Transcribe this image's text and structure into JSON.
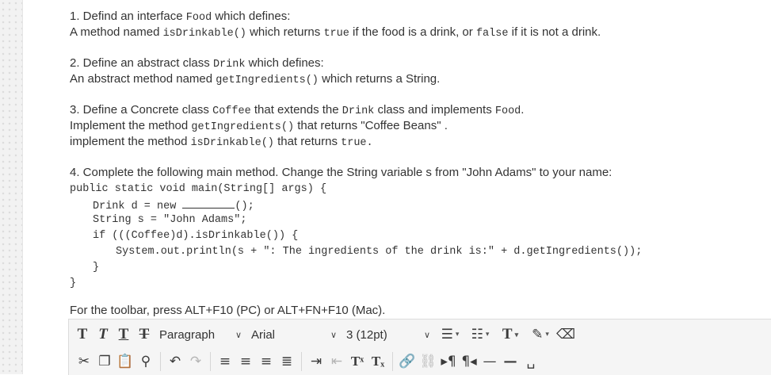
{
  "questions": {
    "q1": {
      "l1_a": "1. Defind an interface ",
      "l1_code": "Food",
      "l1_b": " which defines:",
      "l2_a": "A method named ",
      "l2_code1": "isDrinkable()",
      "l2_b": " which returns ",
      "l2_code2": "true",
      "l2_c": " if the food is a drink, or ",
      "l2_code3": "false",
      "l2_d": " if it is not a drink."
    },
    "q2": {
      "l1_a": "2. Define an abstract class ",
      "l1_code": "Drink",
      "l1_b": " which defines:",
      "l2_a": "An abstract method named ",
      "l2_code": "getIngredients()",
      "l2_b": " which returns a String."
    },
    "q3": {
      "l1_a": "3. Define a Concrete class ",
      "l1_code1": "Coffee",
      "l1_b": " that extends the ",
      "l1_code2": "Drink",
      "l1_c": " class and implements ",
      "l1_code3": "Food",
      "l1_d": ".",
      "l2_a": "Implement the method ",
      "l2_code": "getIngredients()",
      "l2_b": " that returns \"Coffee Beans\" .",
      "l3_a": "implement the method ",
      "l3_code1": "isDrinkable()",
      "l3_b": " that returns ",
      "l3_code2": "true."
    },
    "q4": {
      "l1": "4. Complete the following main method. Change the String variable s from \"John Adams\" to your name:",
      "code": {
        "c1": "public static void main(String[] args) {",
        "c2_a": "Drink d = new ",
        "c2_b": "();",
        "c3": "String s = \"John Adams\";",
        "c4": "if (((Coffee)d).isDrinkable()) {",
        "c5": "System.out.println(s + \": The ingredients of the drink is:\" + d.getIngredients());",
        "c6": "}",
        "c7": "}"
      }
    }
  },
  "toolbar_hint": "For the toolbar, press ALT+F10 (PC) or ALT+FN+F10 (Mac).",
  "toolbar": {
    "paragraph": "Paragraph",
    "font": "Arial",
    "size": "3 (12pt)"
  },
  "icons": {
    "bold": "T",
    "italic": "T",
    "underline": "T",
    "strikethrough": "T",
    "superscript": "Tˣ",
    "subscript": "Tₓ",
    "font_color": "T"
  }
}
